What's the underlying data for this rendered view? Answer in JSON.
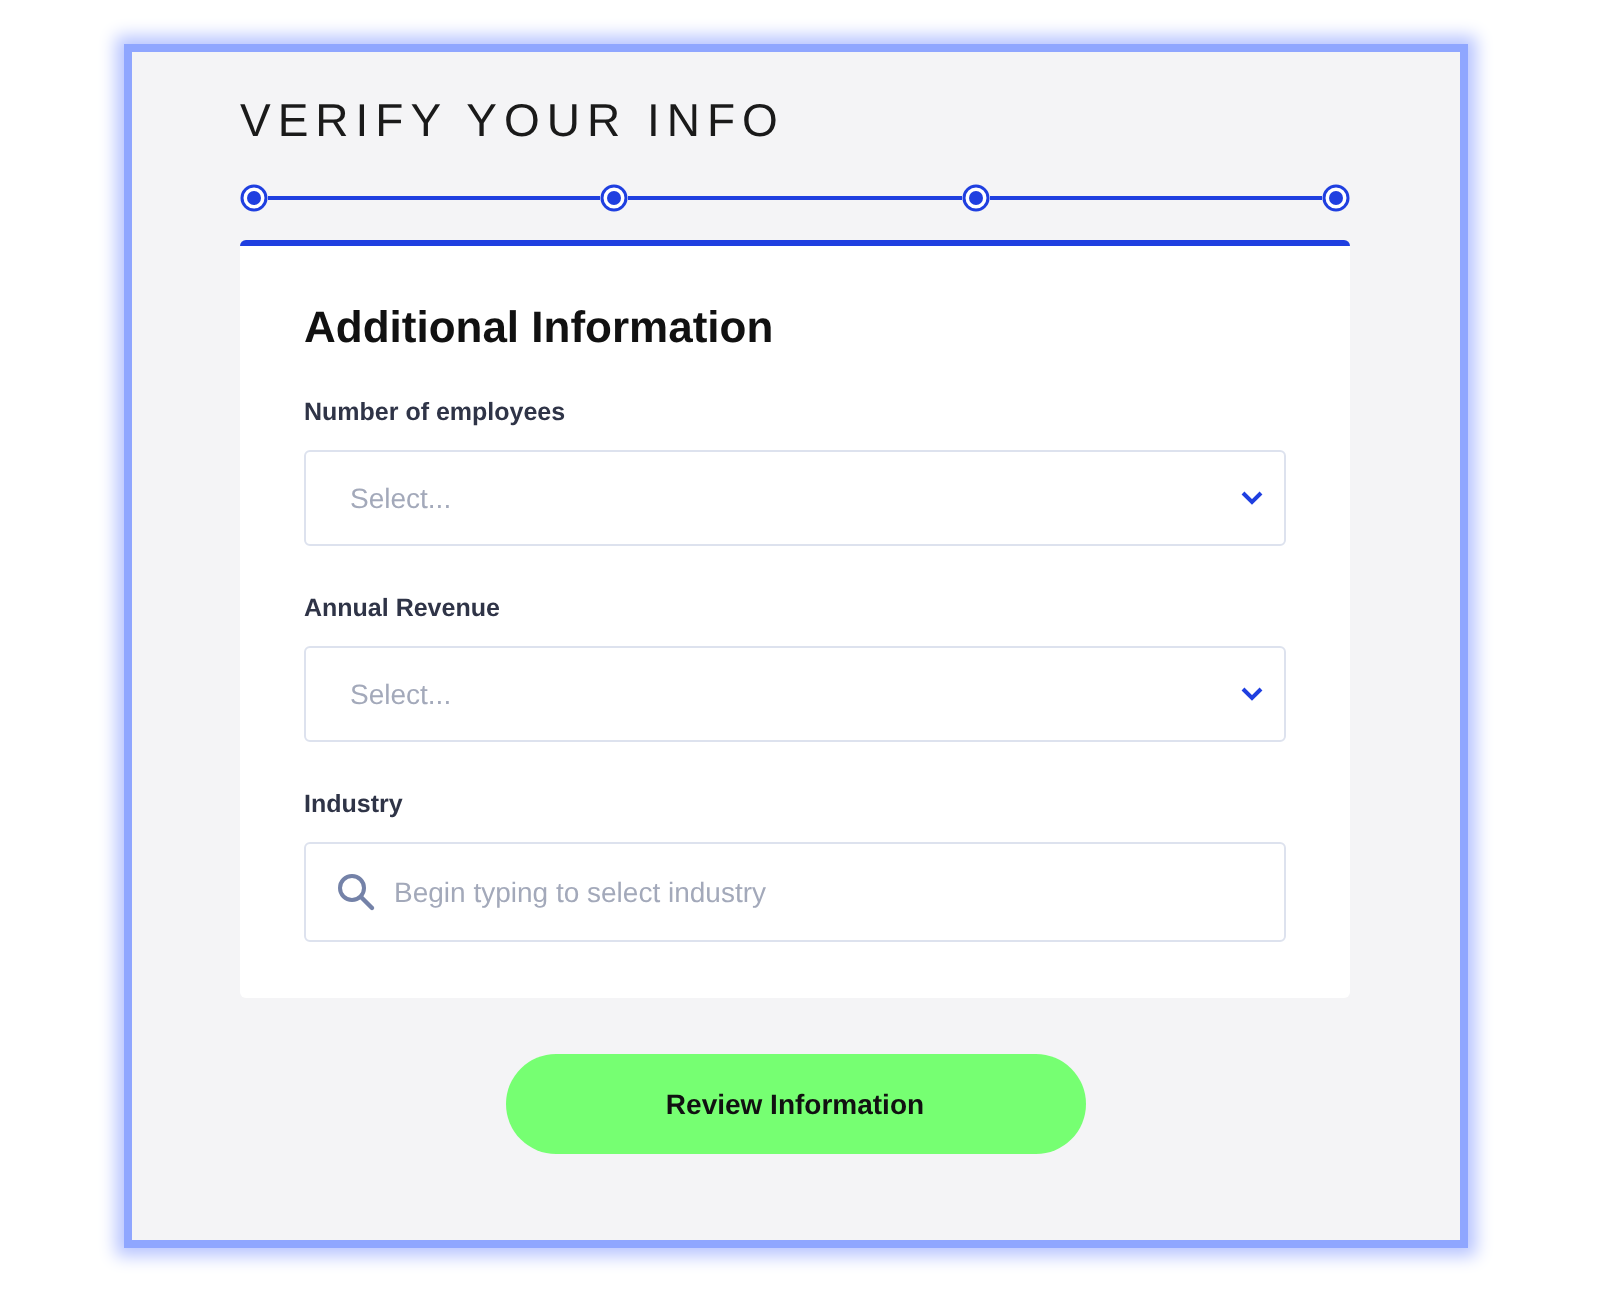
{
  "title": "VERIFY YOUR INFO",
  "steps": [
    {
      "completed": true
    },
    {
      "completed": true
    },
    {
      "completed": true
    },
    {
      "completed": true
    }
  ],
  "card": {
    "heading": "Additional Information",
    "fields": [
      {
        "kind": "select",
        "label": "Number of employees",
        "placeholder": "Select..."
      },
      {
        "kind": "select",
        "label": "Annual Revenue",
        "placeholder": "Select..."
      },
      {
        "kind": "search",
        "label": "Industry",
        "placeholder": "Begin typing to select industry"
      }
    ]
  },
  "button": "Review Information"
}
